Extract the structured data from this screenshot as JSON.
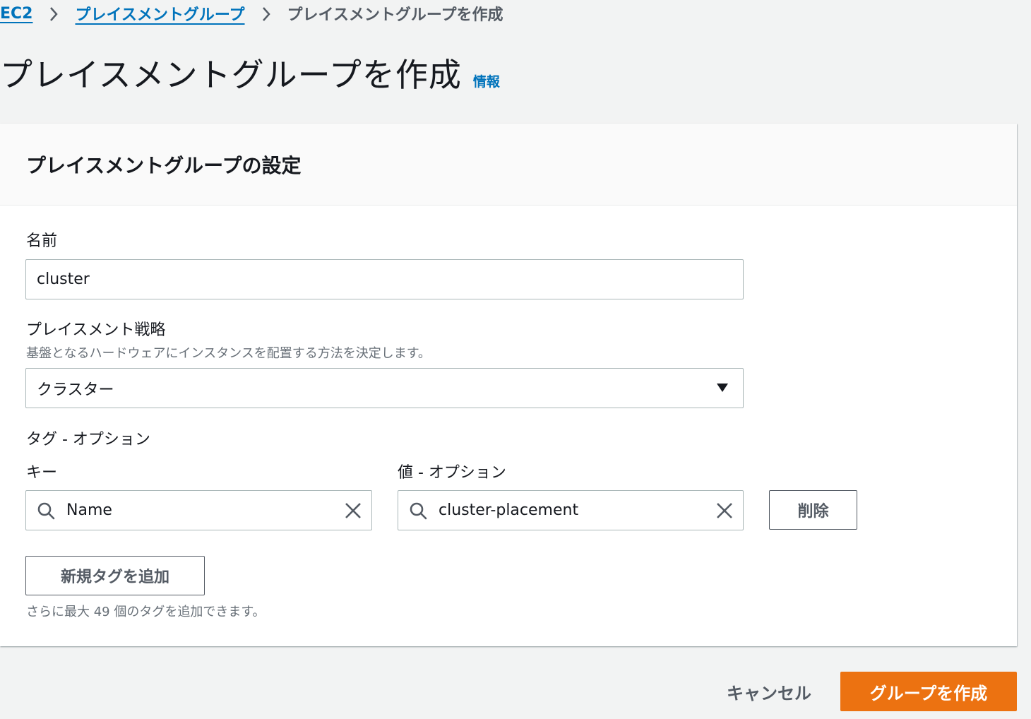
{
  "breadcrumb": {
    "root": "EC2",
    "parent": "プレイスメントグループ",
    "current": "プレイスメントグループを作成"
  },
  "page": {
    "title": "プレイスメントグループを作成",
    "info_link": "情報"
  },
  "panel": {
    "title": "プレイスメントグループの設定"
  },
  "form": {
    "name": {
      "label": "名前",
      "value": "cluster"
    },
    "strategy": {
      "label": "プレイスメント戦略",
      "description": "基盤となるハードウェアにインスタンスを配置する方法を決定します。",
      "selected": "クラスター"
    },
    "tags": {
      "section_label": "タグ - オプション",
      "key_label": "キー",
      "value_label": "値 - オプション",
      "rows": [
        {
          "key": "Name",
          "value": "cluster-placement",
          "remove_label": "削除"
        }
      ],
      "add_button": "新規タグを追加",
      "hint": "さらに最大 49 個のタグを追加できます。"
    }
  },
  "footer": {
    "cancel": "キャンセル",
    "create": "グループを作成"
  },
  "colors": {
    "link": "#0073bb",
    "primary": "#ec7211",
    "background": "#f2f3f3"
  },
  "icons": {
    "breadcrumb_separator": "chevron-right-icon",
    "select_caret": "caret-down-icon",
    "search": "search-icon",
    "clear": "close-icon"
  }
}
